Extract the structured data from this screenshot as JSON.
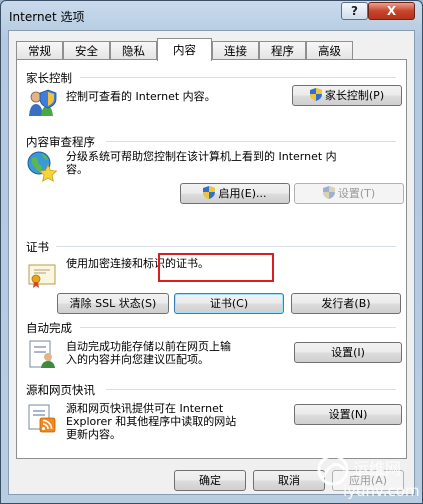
{
  "window": {
    "title": "Internet 选项",
    "help_symbol": "?",
    "close_symbol": "X"
  },
  "tabs": [
    {
      "label": "常规"
    },
    {
      "label": "安全"
    },
    {
      "label": "隐私"
    },
    {
      "label": "内容",
      "active": true
    },
    {
      "label": "连接"
    },
    {
      "label": "程序"
    },
    {
      "label": "高级"
    }
  ],
  "groups": {
    "parental": {
      "title": "家长控制",
      "desc": "控制可查看的 Internet 内容。",
      "button": "家长控制(P)",
      "icon": "family-safety-icon"
    },
    "advisor": {
      "title": "内容审查程序",
      "desc_line1": "分级系统可帮助您控制在该计算机上看到的 Internet 内",
      "desc_line2": "容。",
      "enable_button": "启用(E)...",
      "settings_button": "设置(T)",
      "icon": "globe-star-icon"
    },
    "certs": {
      "title": "证书",
      "desc": "使用加密连接和标识的证书。",
      "clear_ssl_button": "清除 SSL 状态(S)",
      "certificates_button": "证书(C)",
      "publishers_button": "发行者(B)",
      "icon": "certificate-icon"
    },
    "autocomplete": {
      "title": "自动完成",
      "desc_line1": "自动完成功能存储以前在网页上输",
      "desc_line2": "入的内容并向您建议匹配项。",
      "settings_button": "设置(I)",
      "icon": "autocomplete-form-icon"
    },
    "feeds": {
      "title": "源和网页快讯",
      "desc_line1": "源和网页快讯提供可在 Internet",
      "desc_line2": "Explorer 和其他程序中读取的网站",
      "desc_line3": "更新内容。",
      "settings_button": "设置(N)",
      "icon": "rss-feed-icon"
    }
  },
  "footer": {
    "ok_button": "确定",
    "cancel_button": "取消",
    "apply_button": "应用(A)"
  },
  "watermark": {
    "text_cn": "运维网",
    "text_domain": "iyunv.com"
  },
  "colors": {
    "highlight_border": "#d81e1e",
    "close_button": "#c7452b"
  }
}
